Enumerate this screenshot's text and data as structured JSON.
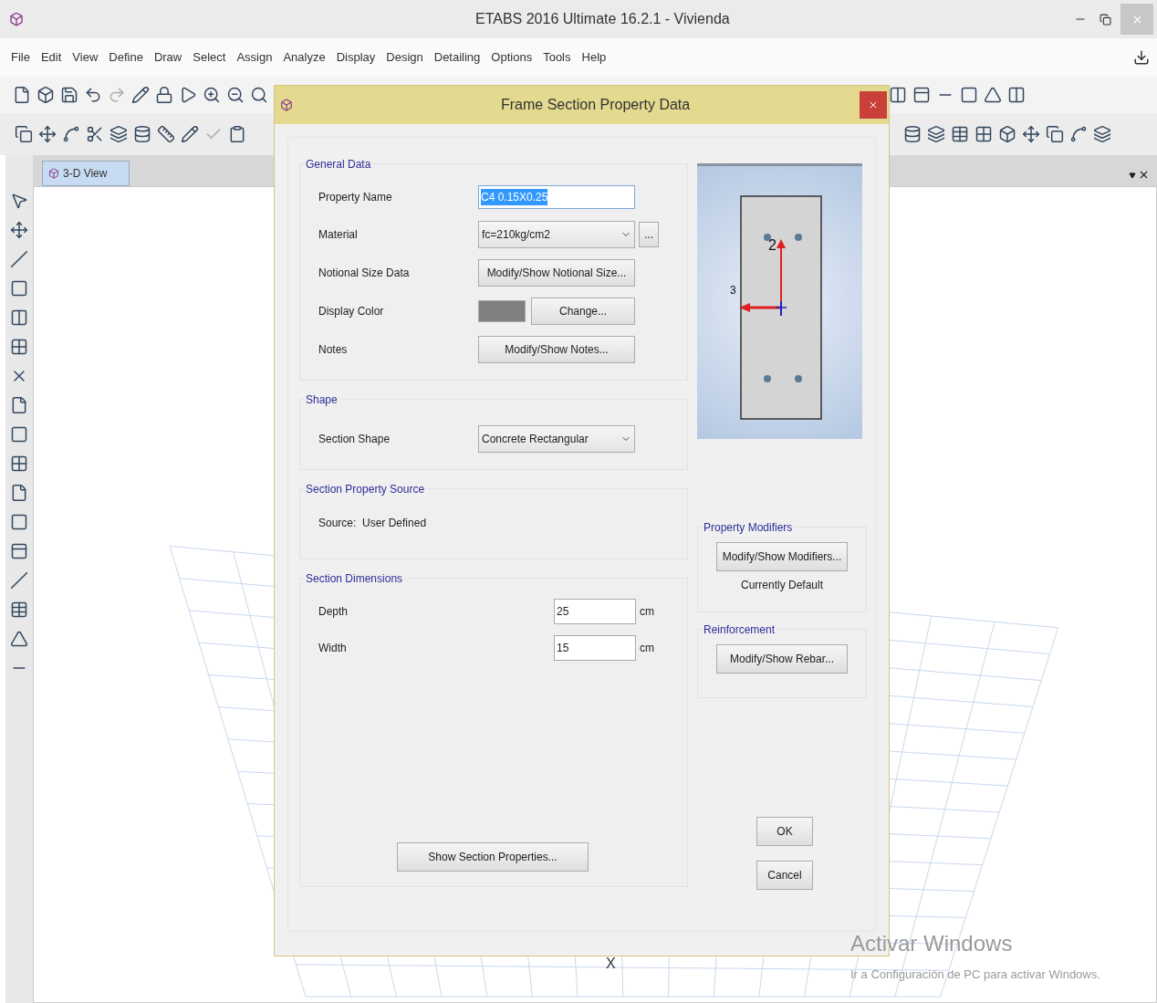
{
  "window": {
    "title": "ETABS 2016 Ultimate 16.2.1 - Vivienda"
  },
  "menu": [
    "File",
    "Edit",
    "View",
    "Define",
    "Draw",
    "Select",
    "Assign",
    "Analyze",
    "Display",
    "Design",
    "Detailing",
    "Options",
    "Tools",
    "Help"
  ],
  "view_tabs": [
    {
      "label": "3-D View",
      "selected": true
    }
  ],
  "canvas": {
    "axis_label": "X"
  },
  "dialog": {
    "title": "Frame Section Property Data",
    "general_data": {
      "title": "General Data",
      "property_name": {
        "label": "Property Name",
        "value": "C4 0.15X0.25"
      },
      "material": {
        "label": "Material",
        "value": "fc=210kg/cm2",
        "more_button": "..."
      },
      "notional_size": {
        "label": "Notional Size Data",
        "button": "Modify/Show Notional Size..."
      },
      "display_color": {
        "label": "Display Color",
        "color": "#808080",
        "button": "Change..."
      },
      "notes": {
        "label": "Notes",
        "button": "Modify/Show Notes..."
      }
    },
    "shape": {
      "title": "Shape",
      "label": "Section Shape",
      "value": "Concrete Rectangular"
    },
    "source": {
      "title": "Section Property Source",
      "text": "Source:  User Defined"
    },
    "dimensions": {
      "title": "Section Dimensions",
      "fields": [
        {
          "label": "Depth",
          "value": "25",
          "unit": "cm"
        },
        {
          "label": "Width",
          "value": "15",
          "unit": "cm"
        }
      ]
    },
    "preview": {
      "axis_labels": [
        "2",
        "3"
      ]
    },
    "property_modifiers": {
      "title": "Property Modifiers",
      "button": "Modify/Show Modifiers...",
      "status": "Currently Default"
    },
    "reinforcement": {
      "title": "Reinforcement",
      "button": "Modify/Show Rebar..."
    },
    "show_properties_button": "Show Section Properties...",
    "ok_button": "OK",
    "cancel_button": "Cancel"
  },
  "activation_notice": {
    "title": "Activar Windows",
    "text": "Ir a Configuración de PC para activar Windows."
  }
}
